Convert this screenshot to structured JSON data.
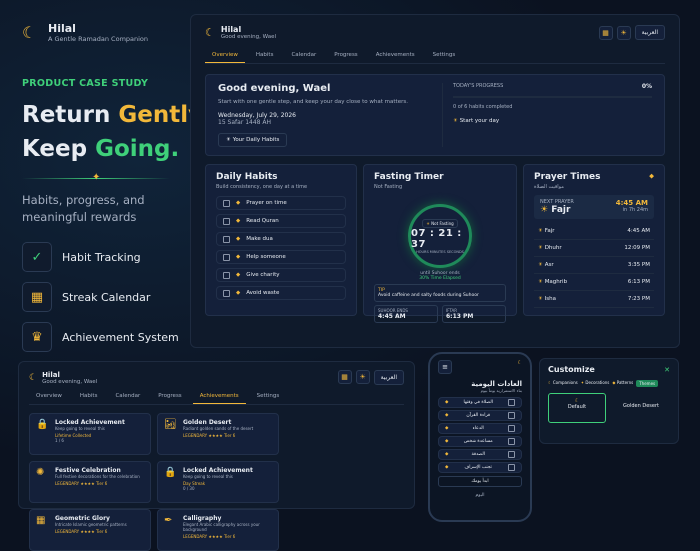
{
  "brand": {
    "name": "Hilal",
    "tagline": "A Gentle Ramadan Companion"
  },
  "hero": {
    "eyebrow": "PRODUCT CASE STUDY",
    "line1a": "Return ",
    "line1b": "Gently.",
    "line2a": "Keep ",
    "line2b": "Going.",
    "desc": "Habits, progress, and meaningful rewards"
  },
  "features": [
    {
      "label": "Habit Tracking",
      "icon": "clipboard-check-icon"
    },
    {
      "label": "Streak Calendar",
      "icon": "calendar-icon"
    },
    {
      "label": "Achievement System",
      "icon": "trophy-icon"
    }
  ],
  "app": {
    "name": "Hilal",
    "greeting_small": "Good evening, Wael",
    "lang": "العربية",
    "tabs": [
      "Overview",
      "Habits",
      "Calendar",
      "Progress",
      "Achievements",
      "Settings"
    ]
  },
  "greet": {
    "title": "Good evening, Wael",
    "sub": "Start with one gentle step, and keep your day close to what matters.",
    "date": "Wednesday, July 29, 2026",
    "hijri": "15 Safar 1448 AH",
    "pill": "Your Daily Habits"
  },
  "progress": {
    "label": "TODAY'S PROGRESS",
    "pct": "0%",
    "fraction": 0,
    "count": "0 of 6 habits completed",
    "cta": "Start your day"
  },
  "habits": {
    "title": "Daily Habits",
    "sub": "Build consistency, one day at a time",
    "items": [
      "Prayer on time",
      "Read Quran",
      "Make dua",
      "Help someone",
      "Give charity",
      "Avoid waste"
    ]
  },
  "fasting": {
    "title": "Fasting Timer",
    "sub": "Not Fasting",
    "status": "Not Fasting",
    "time": "07 : 21 : 37",
    "units": "HOURS   MINUTES   SECONDS",
    "until": "until Suhoor ends",
    "elapsed": "30% Time Elapsed",
    "elapsed_fraction": 0.3,
    "tip_label": "TIP",
    "tip": "Avoid caffeine and salty foods during Suhoor",
    "suhoor_label": "SUHOOR ENDS",
    "suhoor": "4:45 AM",
    "iftar_label": "IFTAR",
    "iftar": "6:13 PM"
  },
  "prayer": {
    "title": "Prayer Times",
    "sub": "مواقيت الصلاة",
    "next_label": "NEXT PRAYER",
    "next_name": "Fajr",
    "next_time": "4:45 AM",
    "next_in": "in 7h 24m",
    "list": [
      {
        "name": "Fajr",
        "time": "4:45 AM"
      },
      {
        "name": "Dhuhr",
        "time": "12:09 PM"
      },
      {
        "name": "Asr",
        "time": "3:35 PM"
      },
      {
        "name": "Maghrib",
        "time": "6:13 PM"
      },
      {
        "name": "Isha",
        "time": "7:23 PM"
      }
    ]
  },
  "achievements": {
    "items": [
      {
        "name": "Locked Achievement",
        "desc": "Keep going to reveal this",
        "tag": "Lifetime Collected",
        "progress": "1 / 6"
      },
      {
        "name": "Golden Desert",
        "desc": "Radiant golden sands of the desert",
        "tag": "LEGENDARY ★★★★ Tier 6"
      },
      {
        "name": "Festive Celebration",
        "desc": "Full festive decorations for the celebration",
        "tag": "LEGENDARY ★★★★ Tier 6"
      },
      {
        "name": "Locked Achievement",
        "desc": "Keep going to reveal this",
        "tag": "Day Streak",
        "progress": "0 / 30"
      },
      {
        "name": "Geometric Glory",
        "desc": "Intricate Islamic geometric patterns",
        "tag": "LEGENDARY ★★★★ Tier 6"
      },
      {
        "name": "Calligraphy",
        "desc": "Elegant Arabic calligraphy across your background",
        "tag": "LEGENDARY ★★★★ Tier 6"
      }
    ]
  },
  "phone": {
    "title": "العادات اليومية",
    "sub": "بناء الاستمرارية يوماً بيوم",
    "items": [
      "الصلاة في وقتها",
      "قراءة القرآن",
      "الدعاء",
      "مساعدة شخص",
      "الصدقة",
      "تجنب الإسراف"
    ],
    "cta": "ابدأ يومك",
    "footer": "اليوم"
  },
  "customize": {
    "title": "Customize",
    "tabs": [
      "Companions",
      "Decorations",
      "Patterns",
      "Themes"
    ],
    "opt1": "Default",
    "opt2": "Golden Desert"
  }
}
